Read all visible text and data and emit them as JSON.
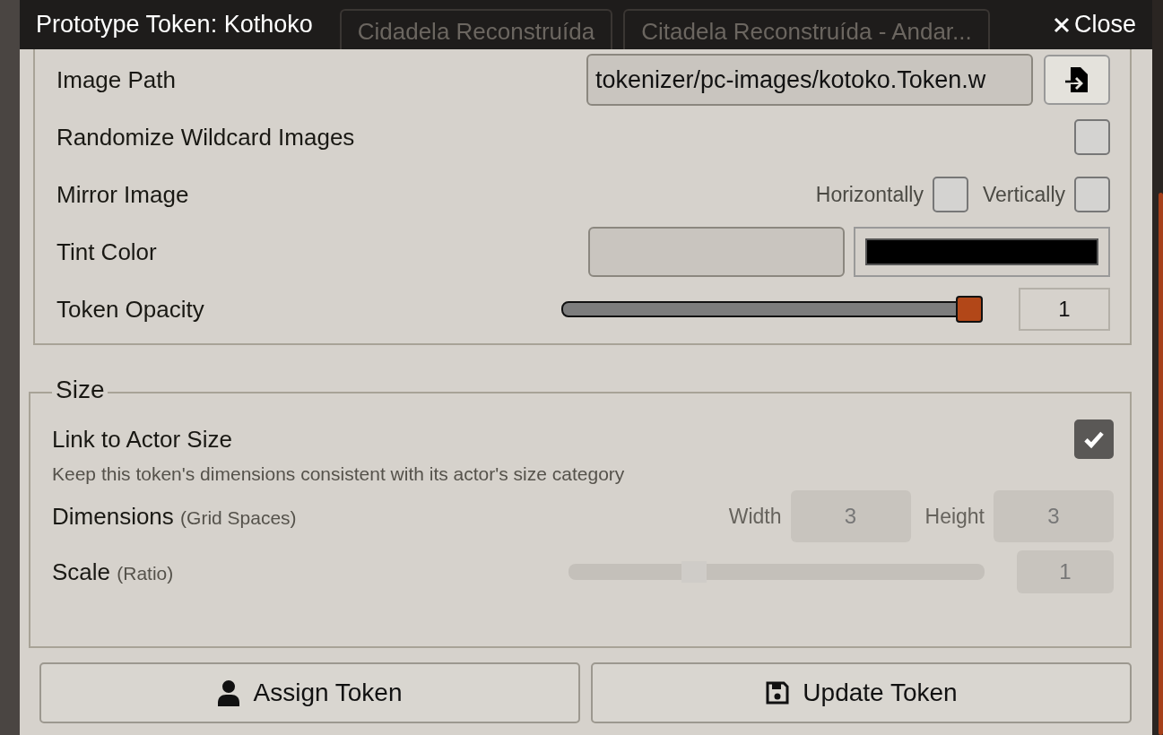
{
  "window": {
    "title": "Prototype Token: Kothoko",
    "close_label": "Close"
  },
  "background_tabs": [
    {
      "label": "Cidadela Reconstruída"
    },
    {
      "label": "Citadela Reconstruída - Andar..."
    }
  ],
  "appearance_rows": [
    {
      "kind": "path",
      "label": "Image Path",
      "value": "tokenizer/pc-images/kotoko.Token.w"
    },
    {
      "kind": "checkbox",
      "label": "Randomize Wildcard Images",
      "checked": false
    },
    {
      "kind": "mirror",
      "label": "Mirror Image",
      "options": [
        {
          "label": "Horizontally",
          "checked": false
        },
        {
          "label": "Vertically",
          "checked": false
        }
      ]
    },
    {
      "kind": "tint",
      "label": "Tint Color",
      "color": "#000000"
    },
    {
      "kind": "slider",
      "label": "Token Opacity",
      "level": 1,
      "reading": "1"
    }
  ],
  "size": {
    "legend": "Size",
    "link": {
      "label": "Link to Actor Size",
      "checked": true,
      "hint": "Keep this token's dimensions consistent with its actor's size category"
    },
    "dimensions": {
      "label": "Dimensions",
      "note": "(Grid Spaces)",
      "disabled": true,
      "fields": [
        {
          "label": "Width",
          "value": "3"
        },
        {
          "label": "Height",
          "value": "3"
        }
      ]
    },
    "scale": {
      "label": "Scale",
      "note": "(Ratio)",
      "disabled": true,
      "level": 0.3,
      "reading": "1"
    }
  },
  "buttons": [
    {
      "label": "Assign Token",
      "kind": "assign"
    },
    {
      "label": "Update Token",
      "kind": "update"
    }
  ]
}
